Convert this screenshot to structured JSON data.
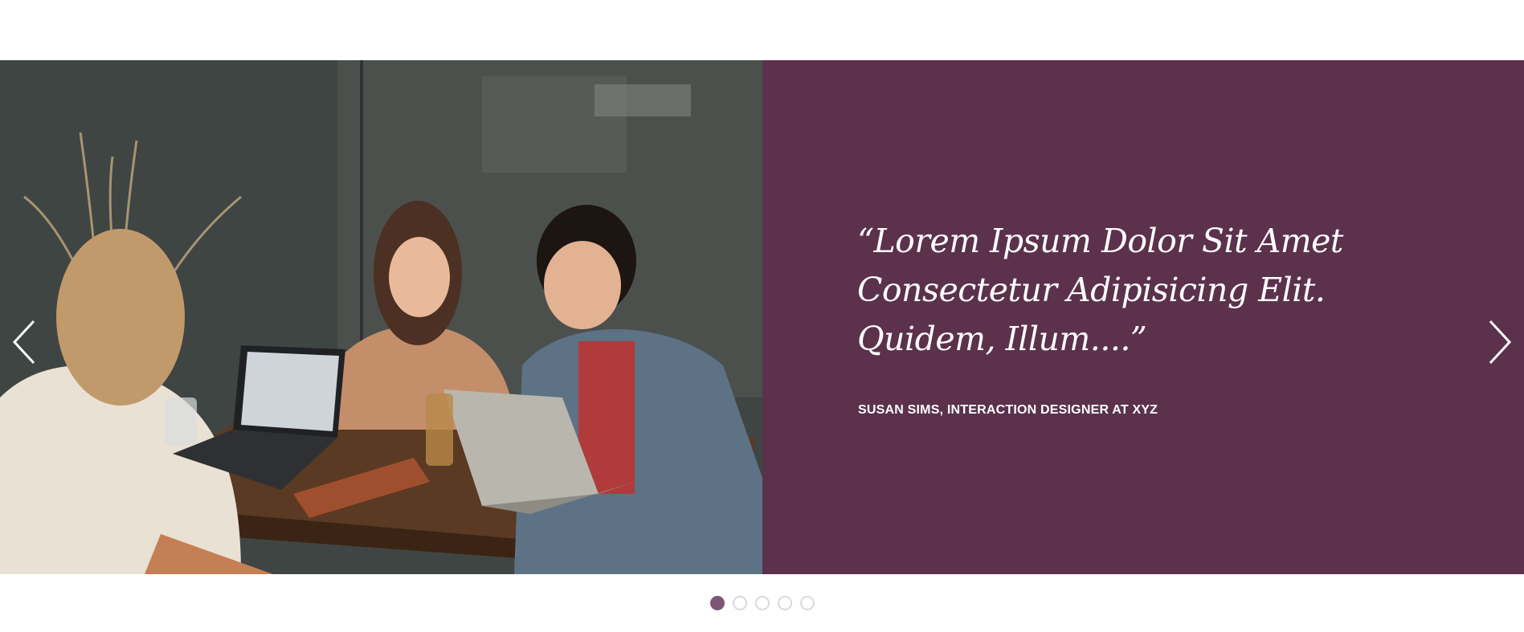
{
  "testimonial": {
    "quote": "“Lorem Ipsum Dolor Sit Amet Consectetur Adipisicing Elit. Quidem, Illum....”",
    "author": "SUSAN SIMS, INTERACTION DESIGNER AT XYZ"
  },
  "photo": {
    "description_icon": "team-meeting-photo"
  },
  "navigation": {
    "prev_icon": "chevron-left-icon",
    "next_icon": "chevron-right-icon"
  },
  "pagination": {
    "total": 5,
    "active_index": 0
  },
  "colors": {
    "panel_background": "#5b314c",
    "dot_active": "#7d5672",
    "dot_inactive_border": "#d9d9d9"
  }
}
